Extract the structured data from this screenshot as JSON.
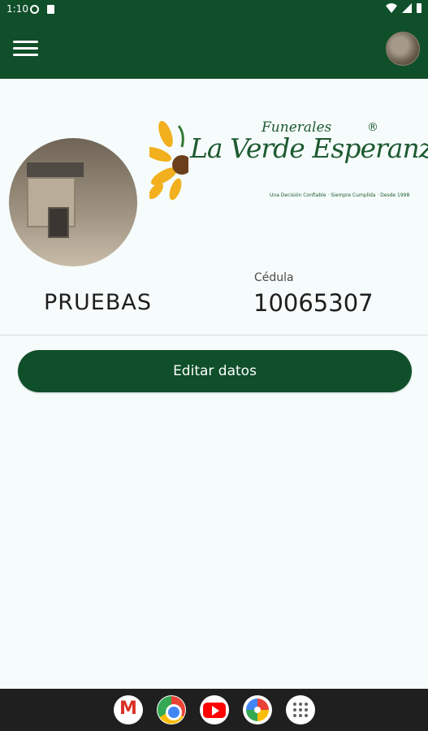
{
  "status_bar": {
    "time": "1:10"
  },
  "app_bar": {
    "menu_icon": "hamburger-menu-icon",
    "avatar": "user-avatar-thumbnail"
  },
  "logo": {
    "small_text": "Funerales",
    "main_text": "La Verde Esperanza",
    "registered": "®",
    "tagline": "Una Decisión Confiable · Siempre Cumplida · Desde 1998"
  },
  "profile": {
    "photo": "kitchen-photo",
    "name": "PRUEBAS",
    "cedula_label": "Cédula",
    "cedula_value": "10065307"
  },
  "actions": {
    "edit_label": "Editar datos"
  },
  "nav_bar": {
    "apps": [
      "gmail-icon",
      "chrome-icon",
      "youtube-icon",
      "photos-icon",
      "app-drawer-icon"
    ]
  },
  "colors": {
    "primary": "#0f4f2a",
    "background": "#f6fcfb"
  }
}
